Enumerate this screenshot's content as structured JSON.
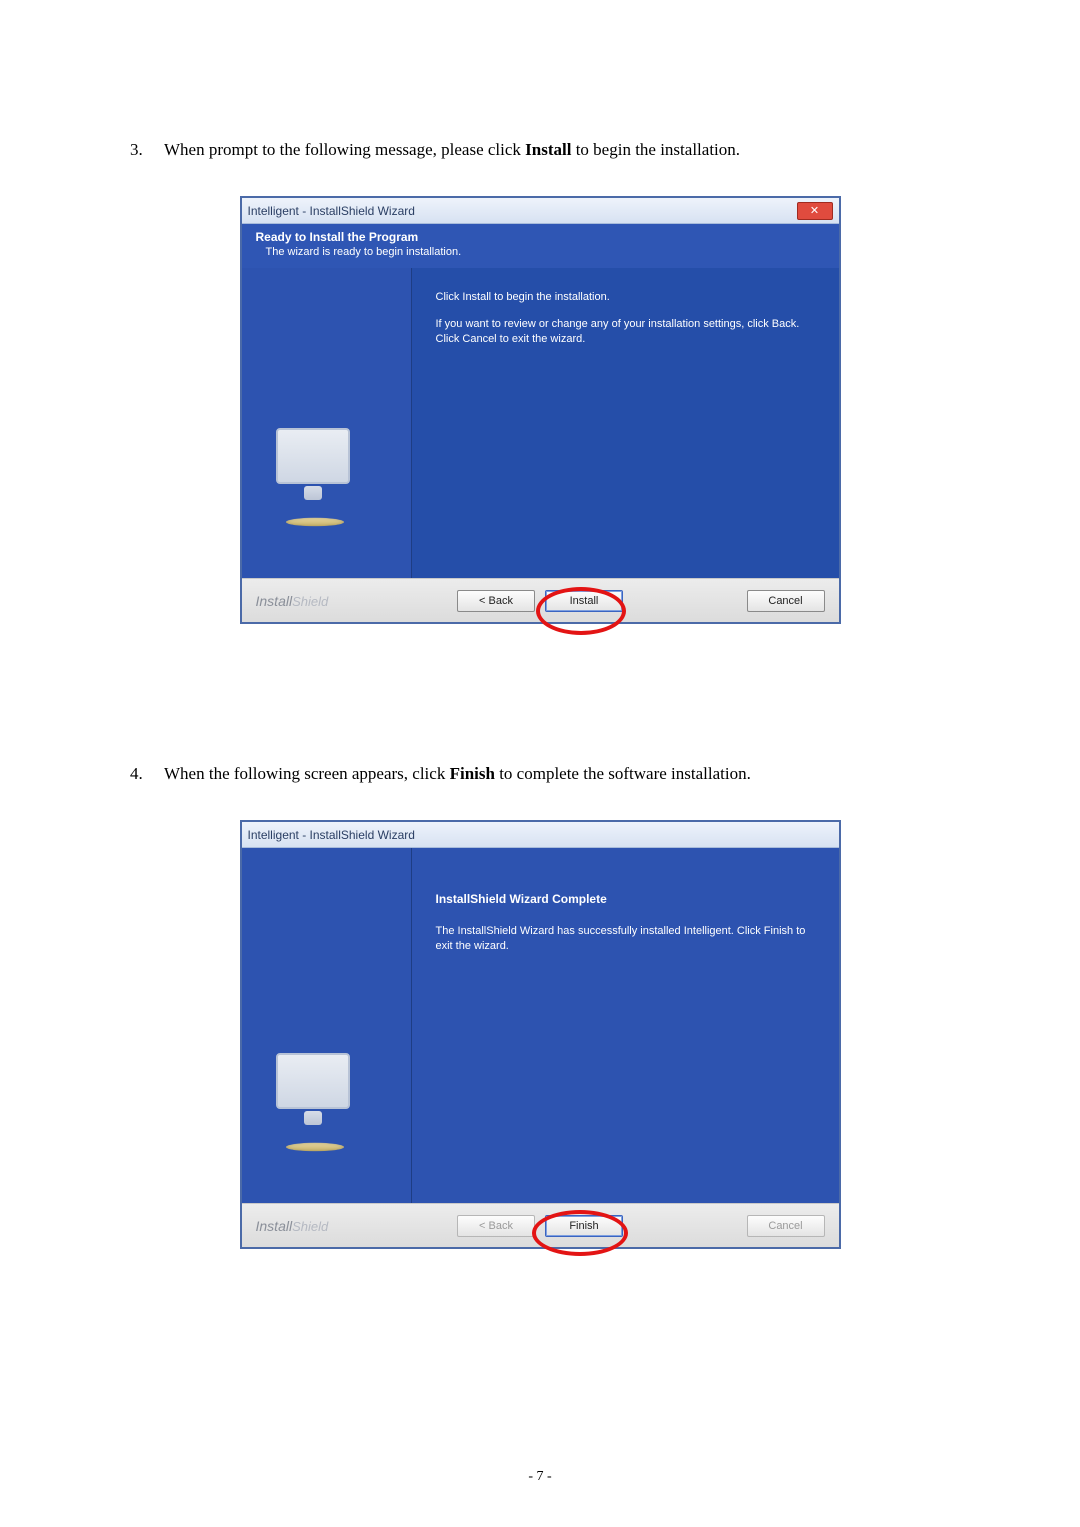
{
  "step3": {
    "num": "3.",
    "text_before": "When prompt to the following message, please click ",
    "bold": "Install",
    "text_after": " to begin the installation."
  },
  "step4": {
    "num": "4.",
    "text_before": "When the following screen appears, click ",
    "bold": "Finish",
    "text_after": " to complete the software installation."
  },
  "dialog1": {
    "title": "Intelligent - InstallShield Wizard",
    "close_glyph": "✕",
    "banner_title": "Ready to Install the Program",
    "banner_sub": "The wizard is ready to begin installation.",
    "body_line1": "Click Install to begin the installation.",
    "body_line2": "If you want to review or change any of your installation settings, click Back. Click Cancel to exit the wizard.",
    "brand1": "Install",
    "brand2": "Shield",
    "back": "< Back",
    "install": "Install",
    "cancel": "Cancel"
  },
  "dialog2": {
    "title": "Intelligent - InstallShield Wizard",
    "heading": "InstallShield Wizard Complete",
    "body": "The InstallShield Wizard has successfully installed Intelligent.  Click Finish to exit the wizard.",
    "brand1": "Install",
    "brand2": "Shield",
    "back": "< Back",
    "finish": "Finish",
    "cancel": "Cancel"
  },
  "page_number": "- 7 -"
}
